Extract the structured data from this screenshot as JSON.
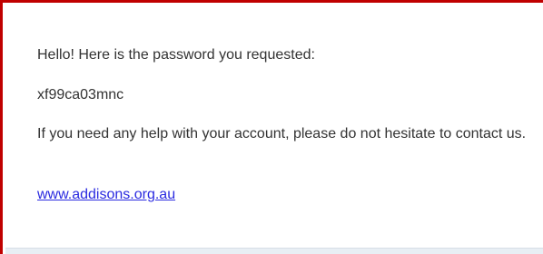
{
  "email": {
    "greeting": "Hello! Here is the password you requested:",
    "password": "xf99ca03mnc",
    "help_text": "If you need any help with your account, please do not hesitate to contact us.",
    "link_text": "www.addisons.org.au"
  },
  "colors": {
    "frame_border": "#c00000",
    "link": "#2a2ae0",
    "text": "#333333"
  }
}
